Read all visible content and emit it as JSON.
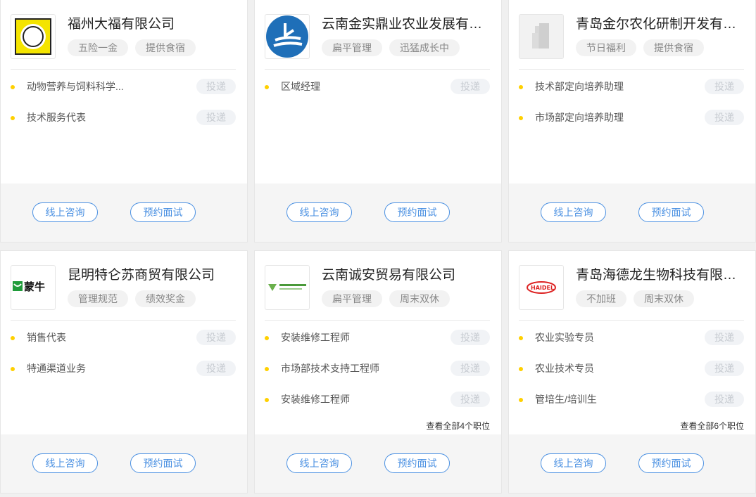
{
  "cards": [
    {
      "company": "福州大福有限公司",
      "logo": "fuzhou-dafu-logo",
      "tags": [
        "五险一金",
        "提供食宿"
      ],
      "jobs": [
        "动物营养与饲料科学...",
        "技术服务代表"
      ],
      "more": "",
      "apply_label": "投递",
      "consult_label": "线上咨询",
      "reserve_label": "预约面试"
    },
    {
      "company": "云南金实鼎业农业发展有限...",
      "logo": "yunnan-jinshi-logo",
      "tags": [
        "扁平管理",
        "迅猛成长中"
      ],
      "jobs": [
        "区域经理"
      ],
      "more": "",
      "apply_label": "投递",
      "consult_label": "线上咨询",
      "reserve_label": "预约面试"
    },
    {
      "company": "青岛金尔农化研制开发有限...",
      "logo": "building-placeholder-logo",
      "tags": [
        "节日福利",
        "提供食宿"
      ],
      "jobs": [
        "技术部定向培养助理",
        "市场部定向培养助理"
      ],
      "more": "",
      "apply_label": "投递",
      "consult_label": "线上咨询",
      "reserve_label": "预约面试"
    },
    {
      "company": "昆明特仑苏商贸有限公司",
      "logo": "mengniu-logo",
      "logo_text": "蒙牛",
      "tags": [
        "管理规范",
        "绩效奖金"
      ],
      "jobs": [
        "销售代表",
        "特通渠道业务"
      ],
      "more": "",
      "apply_label": "投递",
      "consult_label": "线上咨询",
      "reserve_label": "预约面试"
    },
    {
      "company": "云南诚安贸易有限公司",
      "logo": "yunnan-chengan-logo",
      "tags": [
        "扁平管理",
        "周末双休"
      ],
      "jobs": [
        "安装维修工程师",
        "市场部技术支持工程师",
        "安装维修工程师"
      ],
      "more": "查看全部4个职位",
      "apply_label": "投递",
      "consult_label": "线上咨询",
      "reserve_label": "预约面试"
    },
    {
      "company": "青岛海德龙生物科技有限公司",
      "logo": "haidel-logo",
      "logo_text": "HAIDEL",
      "tags": [
        "不加班",
        "周末双休"
      ],
      "jobs": [
        "农业实验专员",
        "农业技术专员",
        "管培生/培训生"
      ],
      "more": "查看全部6个职位",
      "apply_label": "投递",
      "consult_label": "线上咨询",
      "reserve_label": "预约面试"
    }
  ],
  "colors": {
    "accent": "#4a90e2",
    "dot": "#ffd000"
  }
}
